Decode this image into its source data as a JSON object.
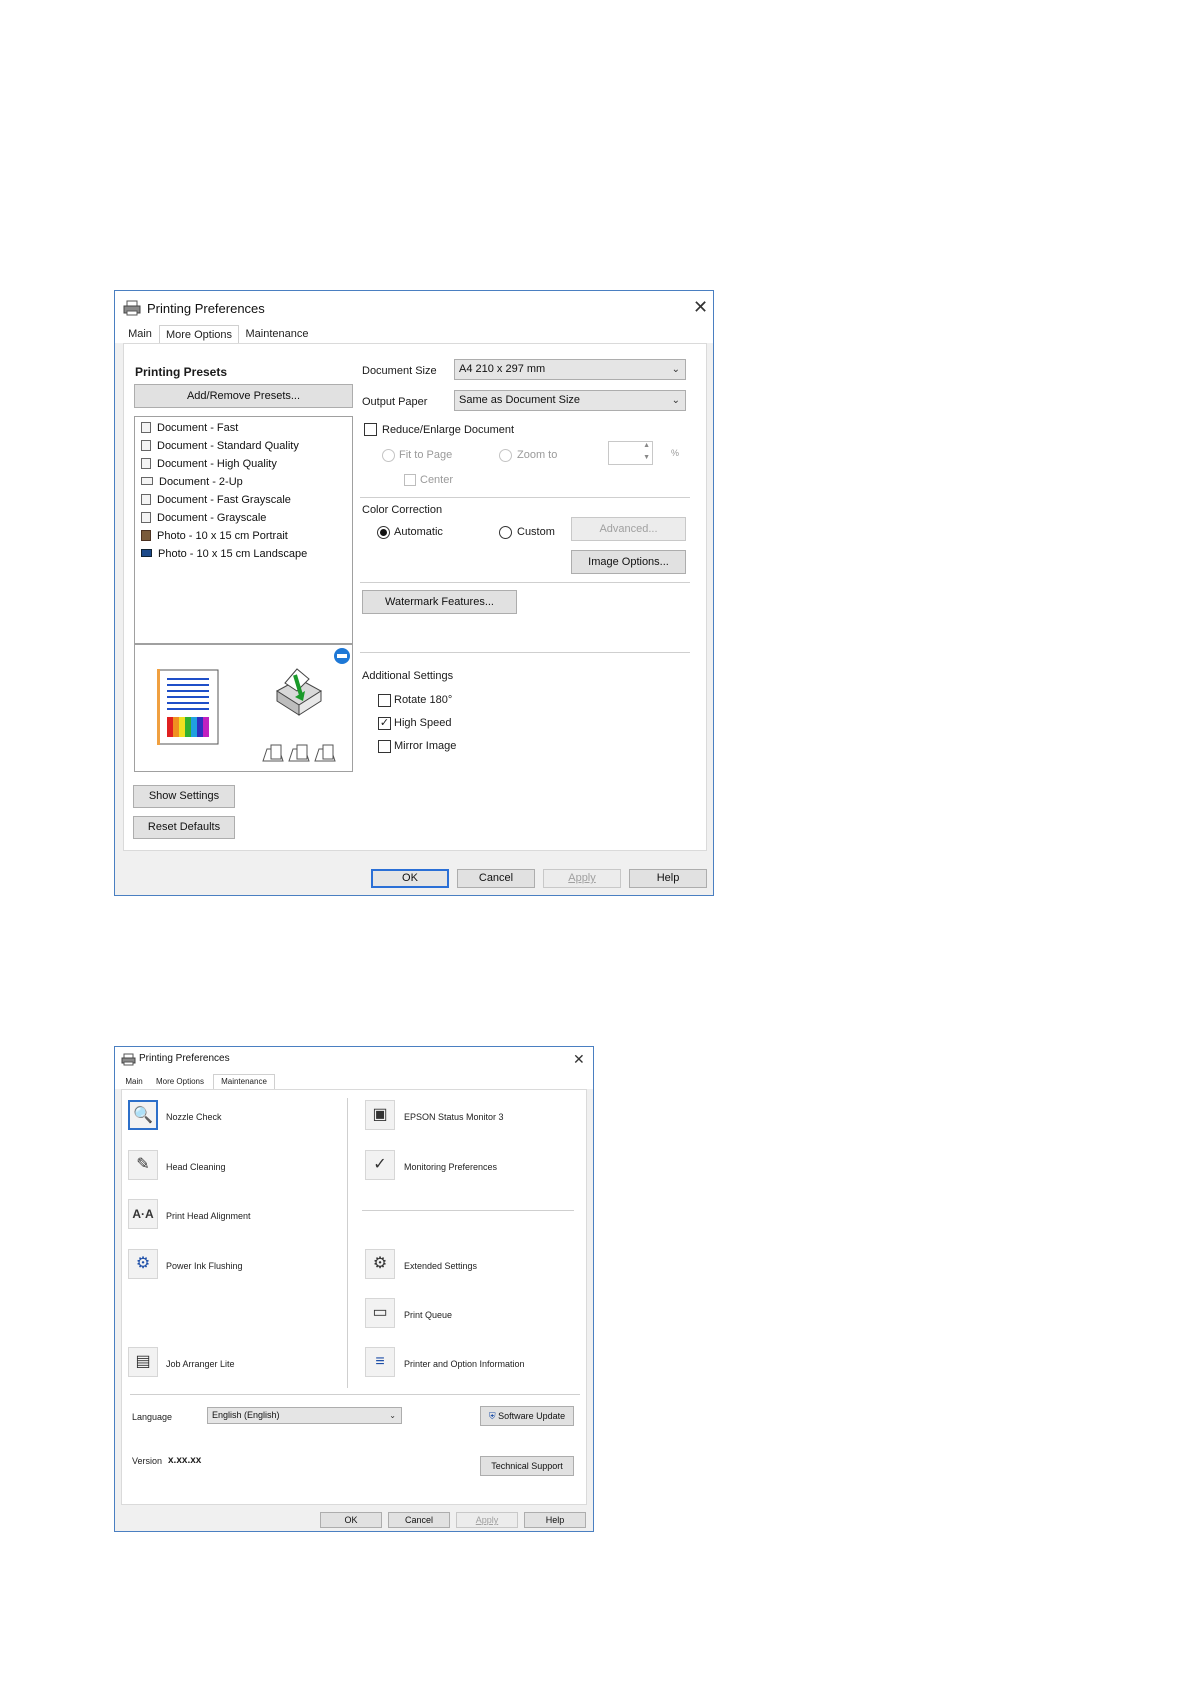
{
  "dialog1": {
    "title": "Printing Preferences",
    "tabs": [
      "Main",
      "More Options",
      "Maintenance"
    ],
    "active_tab": "More Options",
    "printing_presets": {
      "heading": "Printing Presets",
      "add_remove_button": "Add/Remove Presets...",
      "items": [
        "Document - Fast",
        "Document - Standard Quality",
        "Document - High Quality",
        "Document - 2-Up",
        "Document - Fast Grayscale",
        "Document - Grayscale",
        "Photo - 10 x 15 cm Portrait",
        "Photo - 10 x 15 cm Landscape"
      ]
    },
    "show_settings_button": "Show Settings",
    "reset_defaults_button": "Reset Defaults",
    "document_size": {
      "label": "Document Size",
      "value": "A4 210 x 297 mm"
    },
    "output_paper": {
      "label": "Output Paper",
      "value": "Same as Document Size"
    },
    "reduce_enlarge": {
      "label": "Reduce/Enlarge Document",
      "checked": false,
      "fit_to_page": "Fit to Page",
      "zoom_to": "Zoom to",
      "percent": "%",
      "center": "Center"
    },
    "color_correction": {
      "label": "Color Correction",
      "automatic": "Automatic",
      "custom": "Custom",
      "selected": "Automatic",
      "advanced_button": "Advanced...",
      "image_options_button": "Image Options..."
    },
    "watermark_button": "Watermark Features...",
    "additional_settings": {
      "label": "Additional Settings",
      "rotate": {
        "label": "Rotate 180°",
        "checked": false
      },
      "high_speed": {
        "label": "High Speed",
        "checked": true
      },
      "mirror": {
        "label": "Mirror Image",
        "checked": false
      }
    },
    "buttons": {
      "ok": "OK",
      "cancel": "Cancel",
      "apply": "Apply",
      "help": "Help"
    }
  },
  "dialog2": {
    "title": "Printing Preferences",
    "tabs": [
      "Main",
      "More Options",
      "Maintenance"
    ],
    "active_tab": "Maintenance",
    "left_items": [
      "Nozzle Check",
      "Head Cleaning",
      "Print Head Alignment",
      "Power Ink Flushing",
      "Job Arranger Lite"
    ],
    "right_items": [
      "EPSON Status Monitor 3",
      "Monitoring Preferences",
      "Extended Settings",
      "Print Queue",
      "Printer and Option Information"
    ],
    "language": {
      "label": "Language",
      "value": "English (English)"
    },
    "software_update_button": "Software Update",
    "version": {
      "label": "Version",
      "value": "x.xx.xx"
    },
    "technical_support_button": "Technical Support",
    "buttons": {
      "ok": "OK",
      "cancel": "Cancel",
      "apply": "Apply",
      "help": "Help"
    }
  },
  "icons": {
    "app": "printer-icon",
    "close": "close-icon",
    "dropdown": "chevron-down-icon"
  },
  "colors": {
    "accent": "#2a6fd6",
    "dialog_border": "#4a7fc1"
  }
}
